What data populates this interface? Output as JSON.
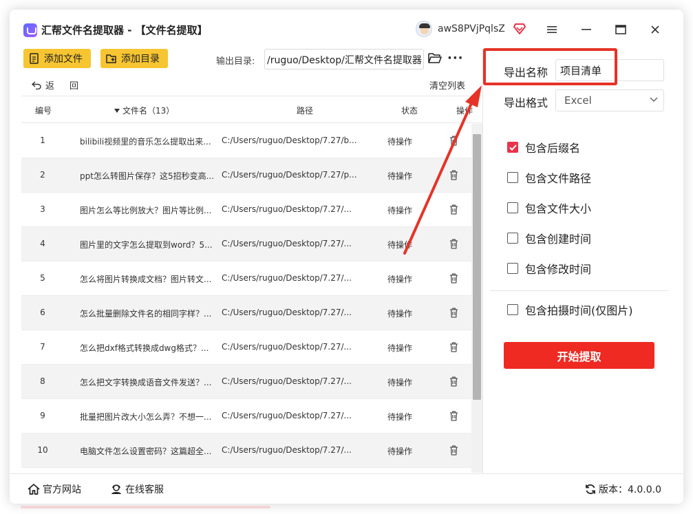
{
  "app": {
    "title": "汇帮文件名提取器 - 【文件名提取】",
    "username": "awS8PVjPqlsZ"
  },
  "toolbar": {
    "add_file_label": "添加文件",
    "add_dir_label": "添加目录",
    "output_label": "输出目录:",
    "output_path": "/ruguo/Desktop/汇帮文件名提取器",
    "more_label": "···"
  },
  "list_actions": {
    "back_label": "返",
    "back_label_2": "回",
    "clear_label": "清空列表"
  },
  "table": {
    "headers": {
      "no": "编号",
      "name": "文件名（13）",
      "path": "路径",
      "status": "状态",
      "op": "操作"
    },
    "rows": [
      {
        "no": "1",
        "name": "bilibili视频里的音乐怎么提取出来...",
        "path": "C:/Users/ruguo/Desktop/7.27/b...",
        "status": "待操作"
      },
      {
        "no": "2",
        "name": "ppt怎么转图片保存？这5招秒变高...",
        "path": "C:/Users/ruguo/Desktop/7.27/p...",
        "status": "待操作"
      },
      {
        "no": "3",
        "name": "图片怎么等比例放大？图片等比例...",
        "path": "C:/Users/ruguo/Desktop/7.27/...",
        "status": "待操作"
      },
      {
        "no": "4",
        "name": "图片里的文字怎么提取到word？5...",
        "path": "C:/Users/ruguo/Desktop/7.27/...",
        "status": "待操作"
      },
      {
        "no": "5",
        "name": "怎么将图片转换成文档？图片转文...",
        "path": "C:/Users/ruguo/Desktop/7.27/...",
        "status": "待操作"
      },
      {
        "no": "6",
        "name": "怎么批量删除文件名的相同字样？...",
        "path": "C:/Users/ruguo/Desktop/7.27/...",
        "status": "待操作"
      },
      {
        "no": "7",
        "name": "怎么把dxf格式转换成dwg格式？...",
        "path": "C:/Users/ruguo/Desktop/7.27/...",
        "status": "待操作"
      },
      {
        "no": "8",
        "name": "怎么把文字转换成语音文件发送？...",
        "path": "C:/Users/ruguo/Desktop/7.27/...",
        "status": "待操作"
      },
      {
        "no": "9",
        "name": "批量把图片改大小怎么弄？不想一...",
        "path": "C:/Users/ruguo/Desktop/7.27/...",
        "status": "待操作"
      },
      {
        "no": "10",
        "name": "电脑文件怎么设置密码？这篇超全...",
        "path": "C:/Users/ruguo/Desktop/7.27/...",
        "status": "待操作"
      }
    ]
  },
  "export": {
    "name_label": "导出名称",
    "name_value": "项目清单",
    "format_label": "导出格式",
    "format_value": "Excel",
    "options": [
      {
        "label": "包含后缀名",
        "checked": true
      },
      {
        "label": "包含文件路径",
        "checked": false
      },
      {
        "label": "包含文件大小",
        "checked": false
      },
      {
        "label": "包含创建时间",
        "checked": false
      },
      {
        "label": "包含修改时间",
        "checked": false
      },
      {
        "label": "包含拍摄时间(仅图片)",
        "checked": false
      }
    ],
    "start_label": "开始提取"
  },
  "footer": {
    "website_label": "官方网站",
    "support_label": "在线客服",
    "version_label": "版本：4.0.0.0"
  },
  "colors": {
    "accent_yellow": "#f7c531",
    "accent_red": "#ee2a22",
    "check_red": "#e8344b"
  }
}
